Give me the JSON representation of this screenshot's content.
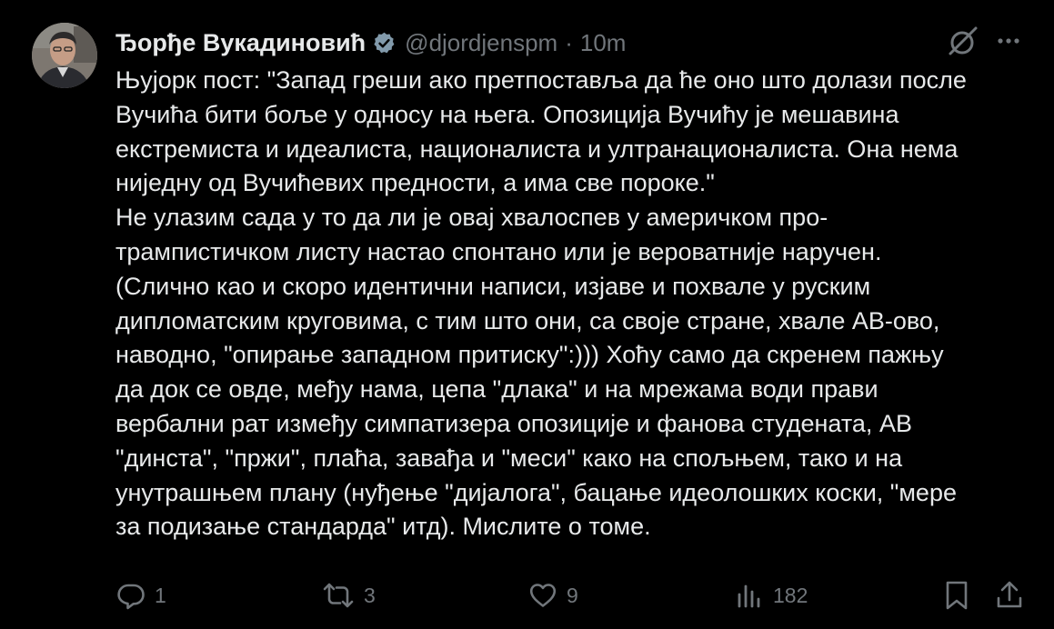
{
  "author": {
    "name": "Ђорђе Вукадиновић",
    "handle": "@djordjenspm",
    "separator": "·",
    "time": "10m"
  },
  "icons": {
    "verified": "verified-badge-icon",
    "grok": "grok-icon",
    "more": "more-options-icon",
    "reply": "reply-icon",
    "repost": "repost-icon",
    "like": "heart-icon",
    "views": "views-icon",
    "bookmark": "bookmark-icon",
    "share": "share-icon"
  },
  "text_lines": [
    "Њујорк пост: \"Запад греши ако претпоставља да ће оно што долази после",
    "Вучића бити боље у односу на њега. Опозиција Вучићу је мешавина",
    "екстремиста и идеалиста, националиста и ултранационалиста. Она нема",
    "ниједну од Вучићевих предности, а има све пороке.\"",
    "Не улазим сада у то да ли је овај хвалоспев у америчком про-",
    "трампистичком листу настао спонтано или је вероватније наручен.",
    "(Слично као и скоро идентични написи, изјаве и похвале у руским",
    "дипломатским круговима, с тим што они, са своје стране, хвале АВ-ово,",
    "наводно, \"опирање западном притиску\":))) Хоћу само да скренем пажњу",
    "да док се овде, међу нама, цепа \"длака\" и на мрежама води прави",
    "вербални рат између симпатизера опозиције и фанова студената, АВ",
    "\"динста\", \"пржи\", плаћа, завађа и \"меси\" како на спољњем, тако и на",
    "унутрашњем плану (нуђење \"дијалога\", бацање идеолошких коски, \"мере",
    "за подизање стандарда\" итд). Мислите о томе."
  ],
  "actions": {
    "replies": "1",
    "reposts": "3",
    "likes": "9",
    "views": "182"
  },
  "colors": {
    "background": "#000000",
    "text": "#e7e9ea",
    "secondary": "#71767b",
    "verified": "#829aab"
  }
}
